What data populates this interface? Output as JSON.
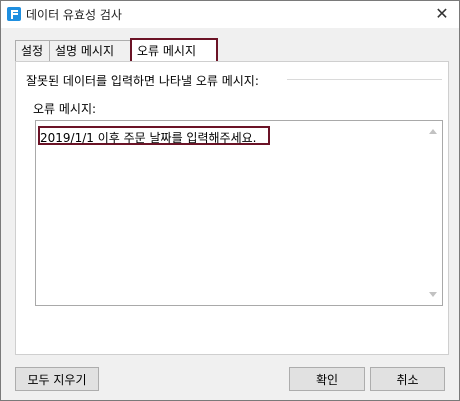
{
  "window": {
    "title": "데이터 유효성 검사",
    "app_icon": "app-f-icon",
    "close_icon": "close-icon"
  },
  "tabs": [
    {
      "label": "설정",
      "active": false
    },
    {
      "label": "설명 메시지",
      "active": false
    },
    {
      "label": "오류 메시지",
      "active": true
    }
  ],
  "error_panel": {
    "group_label": "잘못된 데이터를 입력하면 나타낼 오류 메시지:",
    "field_label": "오류 메시지:",
    "message_value": "2019/1/1 이후 주문 날짜를 입력해주세요."
  },
  "buttons": {
    "clear_all": "모두 지우기",
    "ok": "확인",
    "cancel": "취소"
  },
  "colors": {
    "highlight": "#6b1326",
    "app_icon": "#1f8fe0"
  }
}
